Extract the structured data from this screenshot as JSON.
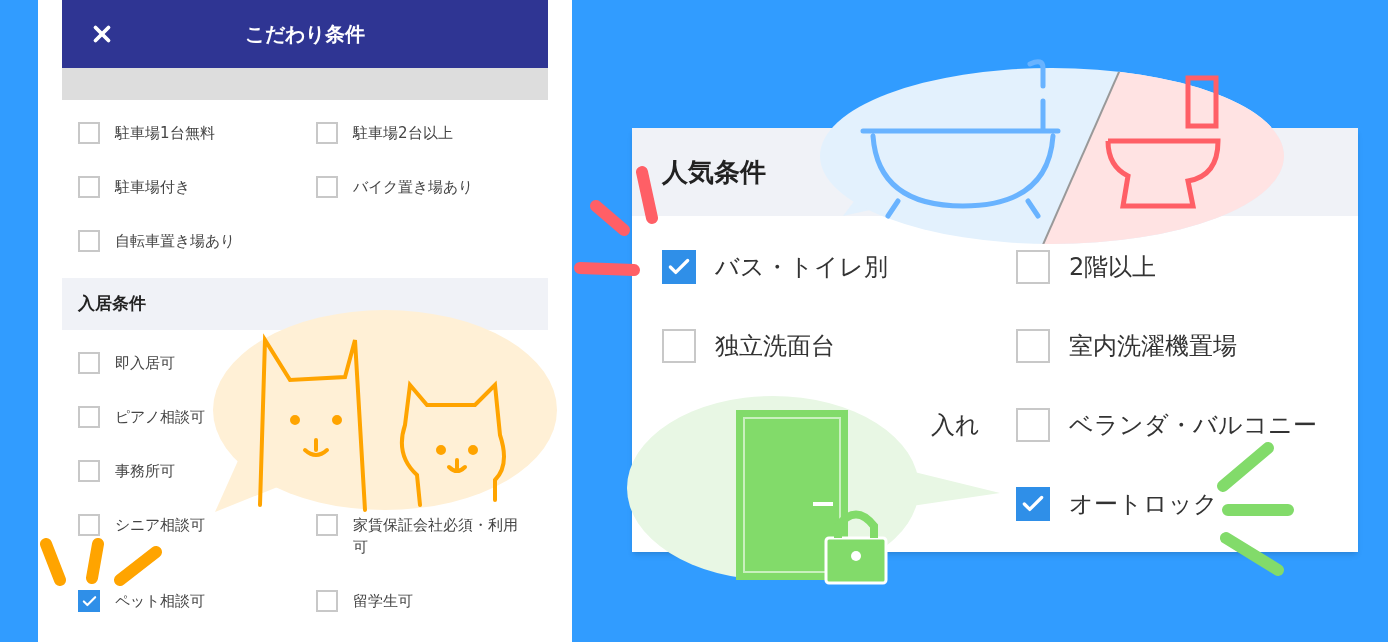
{
  "filter_panel": {
    "title": "こだわり条件",
    "groups": [
      {
        "rows": [
          {
            "left": {
              "label": "駐車場1台無料",
              "checked": false
            },
            "right": {
              "label": "駐車場2台以上",
              "checked": false
            }
          },
          {
            "left": {
              "label": "駐車場付き",
              "checked": false
            },
            "right": {
              "label": "バイク置き場あり",
              "checked": false
            }
          },
          {
            "left": {
              "label": "自転車置き場あり",
              "checked": false
            }
          }
        ]
      },
      {
        "heading": "入居条件",
        "rows": [
          {
            "left": {
              "label": "即入居可",
              "checked": false
            }
          },
          {
            "left": {
              "label": "ピアノ相談可",
              "checked": false
            }
          },
          {
            "left": {
              "label": "事務所可",
              "checked": false
            }
          },
          {
            "left": {
              "label": "シニア相談可",
              "checked": false
            },
            "right": {
              "label": "家賃保証会社必須・利用可",
              "checked": false
            }
          },
          {
            "left": {
              "label": "ペット相談可",
              "checked": true
            },
            "right": {
              "label": "留学生可",
              "checked": false
            }
          }
        ]
      }
    ]
  },
  "popular_panel": {
    "heading": "人気条件",
    "rows": [
      {
        "left": {
          "label": "バス・トイレ別",
          "checked": true
        },
        "right": {
          "label": "2階以上",
          "checked": false
        }
      },
      {
        "left": {
          "label": "独立洗面台",
          "checked": false
        },
        "right": {
          "label": "室内洗濯機置場",
          "checked": false
        }
      },
      {
        "left": {
          "kind": "covered",
          "label": "入れ"
        },
        "right": {
          "label": "ベランダ・バルコニー",
          "checked": false
        }
      },
      {
        "right": {
          "label": "オートロック",
          "checked": true
        }
      }
    ]
  }
}
